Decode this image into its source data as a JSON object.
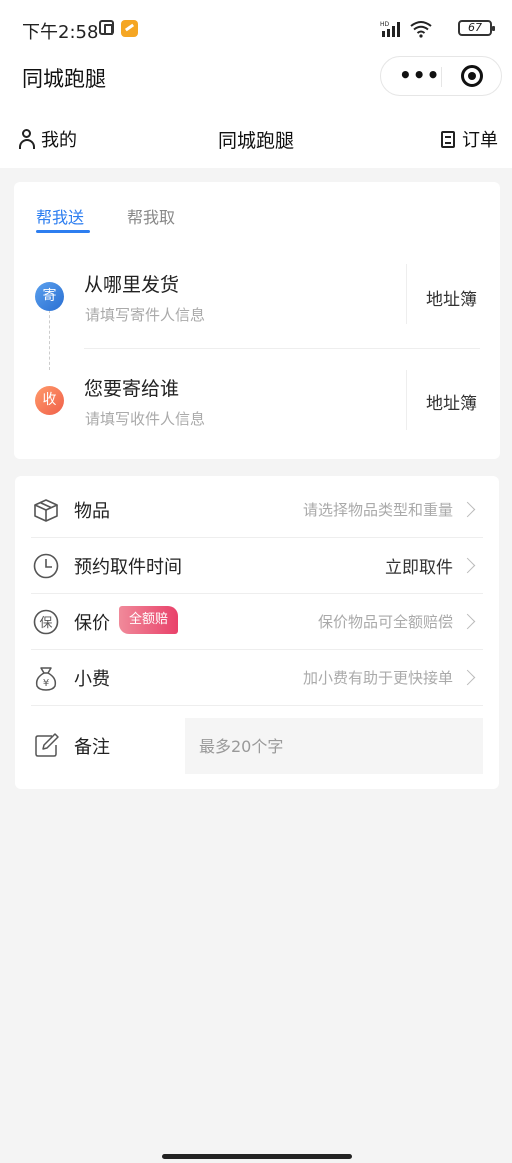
{
  "status": {
    "time": "下午2:58",
    "battery": "67",
    "network": "HD"
  },
  "nav": {
    "title": "同城跑腿",
    "menu_dots": "•••"
  },
  "topbar": {
    "mine": "我的",
    "title": "同城跑腿",
    "orders": "订单"
  },
  "tabs": [
    {
      "label": "帮我送",
      "active": true
    },
    {
      "label": "帮我取",
      "active": false
    }
  ],
  "sender": {
    "badge": "寄",
    "title": "从哪里发货",
    "subtitle": "请填写寄件人信息",
    "book": "地址簿"
  },
  "receiver": {
    "badge": "收",
    "title": "您要寄给谁",
    "subtitle": "请填写收件人信息",
    "book": "地址簿"
  },
  "options": {
    "item": {
      "label": "物品",
      "value": "请选择物品类型和重量"
    },
    "time": {
      "label": "预约取件时间",
      "value": "立即取件"
    },
    "insure": {
      "label": "保价",
      "badge": "全额赔",
      "value": "保价物品可全额赔偿"
    },
    "tip": {
      "label": "小费",
      "value": "加小费有助于更快接单"
    },
    "note": {
      "label": "备注",
      "placeholder": "最多20个字"
    }
  },
  "colors": {
    "accent": "#2d7ef0",
    "send_badge": "#2a6fd2",
    "recv_badge": "#f0604a",
    "insure_badge": "#e9416a"
  }
}
